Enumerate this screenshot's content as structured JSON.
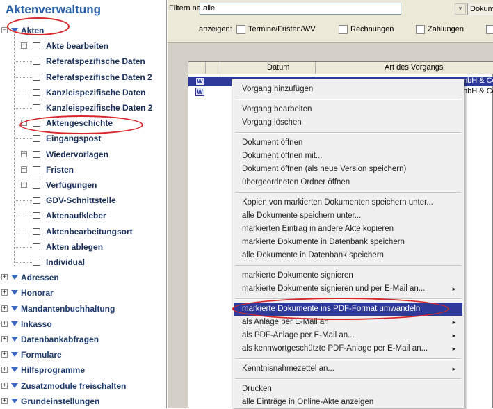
{
  "app_title": "Aktenverwaltung",
  "tree": {
    "akten": {
      "label": "Akten",
      "children": [
        {
          "label": "Akte bearbeiten",
          "expandable": true
        },
        {
          "label": "Referatspezifische Daten",
          "expandable": false
        },
        {
          "label": "Referatspezifische Daten 2",
          "expandable": false
        },
        {
          "label": "Kanzleispezifische Daten",
          "expandable": false
        },
        {
          "label": "Kanzleispezifische Daten 2",
          "expandable": false
        },
        {
          "label": "Aktengeschichte",
          "expandable": true
        },
        {
          "label": "Eingangspost",
          "expandable": false
        },
        {
          "label": "Wiedervorlagen",
          "expandable": true
        },
        {
          "label": "Fristen",
          "expandable": true
        },
        {
          "label": "Verfügungen",
          "expandable": true
        },
        {
          "label": "GDV-Schnittstelle",
          "expandable": false
        },
        {
          "label": "Aktenaufkleber",
          "expandable": false
        },
        {
          "label": "Aktenbearbeitungsort",
          "expandable": false
        },
        {
          "label": "Akten ablegen",
          "expandable": false
        },
        {
          "label": "Individual",
          "expandable": false
        }
      ]
    },
    "top_level": [
      "Adressen",
      "Honorar",
      "Mandantenbuchhaltung",
      "Inkasso",
      "Datenbankabfragen",
      "Formulare",
      "Hilfsprogramme",
      "Zusatzmodule freischalten",
      "Grundeinstellungen"
    ]
  },
  "toolbar": {
    "filter_label": "Filtern nach:",
    "filter_value": "alle",
    "doc_select": "Dokum",
    "show_label": "anzeigen:",
    "checkboxes": [
      "Termine/Fristen/WV",
      "Rechnungen",
      "Zahlungen"
    ]
  },
  "doc_list": {
    "columns": [
      "Datum",
      "Art des Vorgangs"
    ],
    "rows": [
      {
        "icon": "W",
        "partial_right": "mbH & Co"
      },
      {
        "icon": "W",
        "partial_right": "mbH & Co"
      }
    ]
  },
  "context_menu": {
    "groups": [
      [
        {
          "label": "Vorgang hinzufügen",
          "submenu": false
        }
      ],
      [
        {
          "label": "Vorgang bearbeiten",
          "submenu": false
        },
        {
          "label": "Vorgang löschen",
          "submenu": false
        }
      ],
      [
        {
          "label": "Dokument öffnen",
          "submenu": false
        },
        {
          "label": "Dokument öffnen mit...",
          "submenu": false
        },
        {
          "label": "Dokument öffnen (als neue Version speichern)",
          "submenu": false
        },
        {
          "label": "übergeordneten Ordner öffnen",
          "submenu": false
        }
      ],
      [
        {
          "label": "Kopien von markierten Dokumenten speichern unter...",
          "submenu": false
        },
        {
          "label": "alle Dokumente speichern unter...",
          "submenu": false
        },
        {
          "label": "markierten Eintrag in andere Akte kopieren",
          "submenu": false
        },
        {
          "label": "markierte Dokumente in Datenbank speichern",
          "submenu": false
        },
        {
          "label": "alle Dokumente in Datenbank speichern",
          "submenu": false
        }
      ],
      [
        {
          "label": "markierte Dokumente signieren",
          "submenu": false
        },
        {
          "label": "markierte Dokumente signieren und per E-Mail an...",
          "submenu": true
        }
      ],
      [
        {
          "label": "markierte Dokumente ins PDF-Format umwandeln",
          "submenu": false,
          "selected": true
        },
        {
          "label": "als Anlage per E-Mail an",
          "submenu": true
        },
        {
          "label": "als PDF-Anlage per E-Mail an...",
          "submenu": true
        },
        {
          "label": "als kennwortgeschützte PDF-Anlage per E-Mail an...",
          "submenu": true
        }
      ],
      [
        {
          "label": "Kenntnisnahmezettel an...",
          "submenu": true
        }
      ],
      [
        {
          "label": "Drucken",
          "submenu": false
        },
        {
          "label": "alle Einträge in Online-Akte anzeigen",
          "submenu": false
        }
      ]
    ]
  },
  "colors": {
    "title": "#2a5fa8",
    "tree_text": "#1e3b6e",
    "menu_selection": "#2d3a9a",
    "annotation": "#d8262a"
  }
}
